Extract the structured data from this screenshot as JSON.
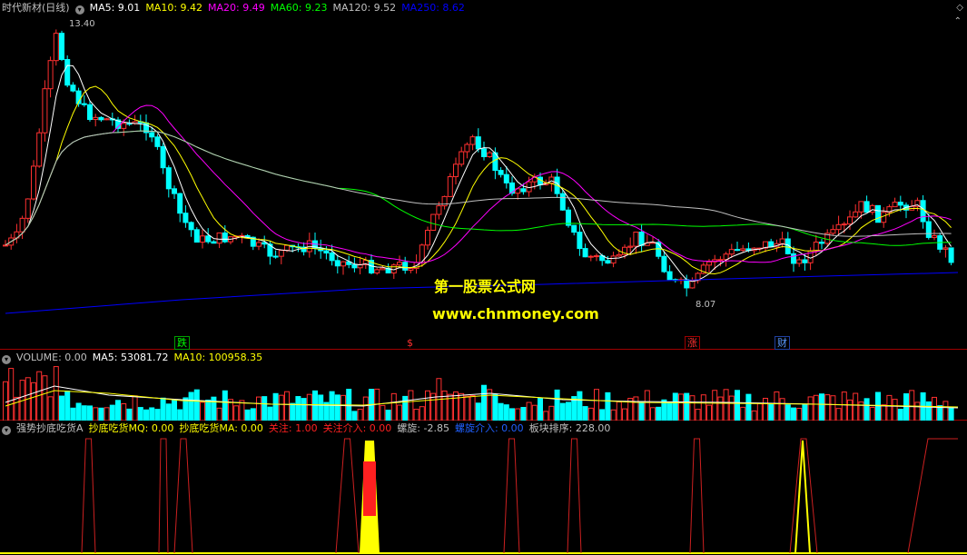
{
  "main_panel": {
    "title": "时代新材(日线)",
    "indicators": [
      {
        "label": "MA5: 9.01",
        "color": "#ffffff"
      },
      {
        "label": "MA10: 9.42",
        "color": "#ffff00"
      },
      {
        "label": "MA20: 9.49",
        "color": "#ff00ff"
      },
      {
        "label": "MA60: 9.23",
        "color": "#00ff00"
      },
      {
        "label": "MA120: 9.52",
        "color": "#c0c0c0"
      },
      {
        "label": "MA250: 8.62",
        "color": "#0000ff"
      }
    ],
    "high_label": "13.40",
    "low_label": "8.07",
    "events": [
      {
        "text": "跌",
        "color": "#00ff00"
      },
      {
        "text": "$",
        "color": "#ff3030"
      },
      {
        "text": "涨",
        "color": "#ff3030"
      },
      {
        "text": "财",
        "color": "#5b9bff"
      }
    ],
    "watermark_title": "第一股票公式网",
    "watermark_url": "www.chnmoney.com"
  },
  "volume_panel": {
    "title": "VOLUME: 0.00",
    "ma5": "MA5: 53081.72",
    "ma10": "MA10: 100958.35"
  },
  "indicator_panel": {
    "title": "强势抄底吃货A",
    "items": [
      {
        "label": "抄底吃货MQ: 0.00",
        "color": "#ffff00"
      },
      {
        "label": "抄底吃货MA: 0.00",
        "color": "#ffff00"
      },
      {
        "label": "关注: 1.00",
        "color": "#ff2020"
      },
      {
        "label": "关注介入: 0.00",
        "color": "#ff2020"
      },
      {
        "label": "螺旋: -2.85",
        "color": "#c0c0c0"
      },
      {
        "label": "螺旋介入: 0.00",
        "color": "#2060ff"
      },
      {
        "label": "板块排序: 228.00",
        "color": "#c0c0c0"
      }
    ]
  },
  "colors": {
    "up": "#ff3030",
    "down": "#00ffff",
    "bg": "#000000",
    "grid": "#a00000"
  }
}
